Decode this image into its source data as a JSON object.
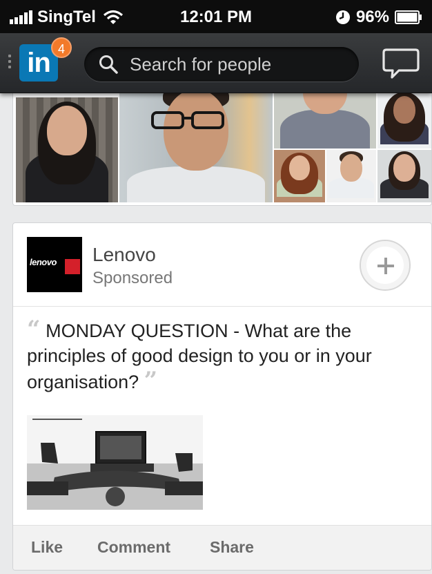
{
  "status_bar": {
    "carrier": "SingTel",
    "time": "12:01 PM",
    "battery": "96%"
  },
  "nav": {
    "logo_text": "in",
    "notification_count": "4",
    "search_placeholder": "Search for people",
    "brand_color": "#0a78b5",
    "badge_color": "#f27a2a"
  },
  "post": {
    "company": "Lenovo",
    "logo_text": "lenovo",
    "label": "Sponsored",
    "text": "MONDAY QUESTION - What are the principles of good design to you or in your organisation?",
    "actions": [
      "Like",
      "Comment",
      "Share"
    ]
  }
}
